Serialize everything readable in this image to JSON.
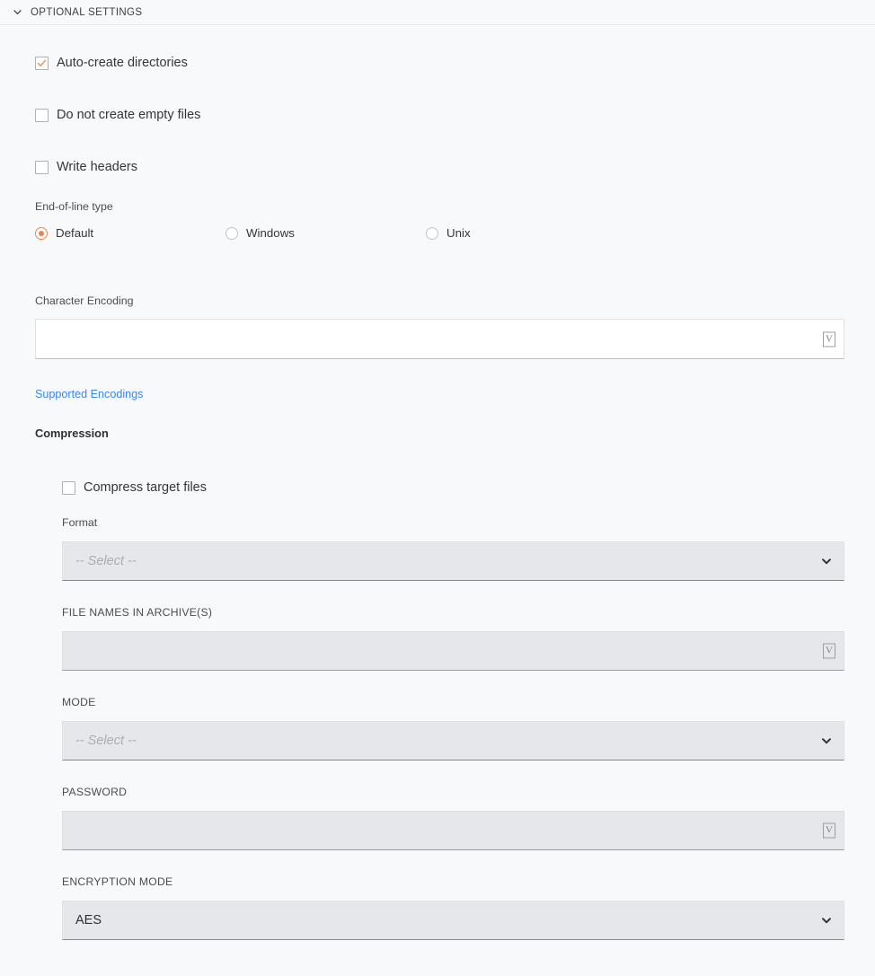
{
  "section": {
    "title": "OPTIONAL SETTINGS",
    "collapse_icon": "chevron-down-icon",
    "expanded": true
  },
  "checkboxes": [
    {
      "label": "Auto-create directories",
      "checked": true
    },
    {
      "label": "Do not create empty files",
      "checked": false
    },
    {
      "label": "Write headers",
      "checked": false
    }
  ],
  "eol": {
    "label": "End-of-line type",
    "selected": "Default",
    "options": [
      {
        "label": "Default",
        "selected": true
      },
      {
        "label": "Windows",
        "selected": false
      },
      {
        "label": "Unix",
        "selected": false
      }
    ]
  },
  "character_encoding": {
    "label": "Character Encoding",
    "value": "",
    "placeholder": "",
    "enabled": true,
    "picker_icon": "missing-glyph-box-icon",
    "picker_glyph": "V"
  },
  "supported_encodings_link": {
    "label": "Supported Encodings",
    "color": "#3b86f0"
  },
  "compression": {
    "heading": "Compression",
    "compress_checkbox": {
      "label": "Compress target files",
      "checked": false
    },
    "format": {
      "label": "Format",
      "value": "",
      "placeholder": "-- Select --",
      "enabled": false,
      "chevron_icon": "chevron-down-icon"
    },
    "file_names_in_archives": {
      "label": "FILE NAMES IN ARCHIVE(S)",
      "value": "",
      "enabled": false,
      "picker_icon": "missing-glyph-box-icon",
      "picker_glyph": "V"
    },
    "mode": {
      "label": "MODE",
      "value": "",
      "placeholder": "-- Select --",
      "enabled": false,
      "chevron_icon": "chevron-down-icon"
    },
    "password": {
      "label": "PASSWORD",
      "value": "",
      "enabled": false,
      "picker_icon": "missing-glyph-box-icon",
      "picker_glyph": "V"
    },
    "encryption_mode": {
      "label": "ENCRYPTION MODE",
      "value": "AES",
      "enabled": false,
      "chevron_icon": "chevron-down-icon"
    }
  },
  "colors": {
    "background": "#f8f9fb",
    "accent": "#ef7f4f",
    "link": "#3b86f0",
    "disabled_field": "#e6e7eb"
  }
}
